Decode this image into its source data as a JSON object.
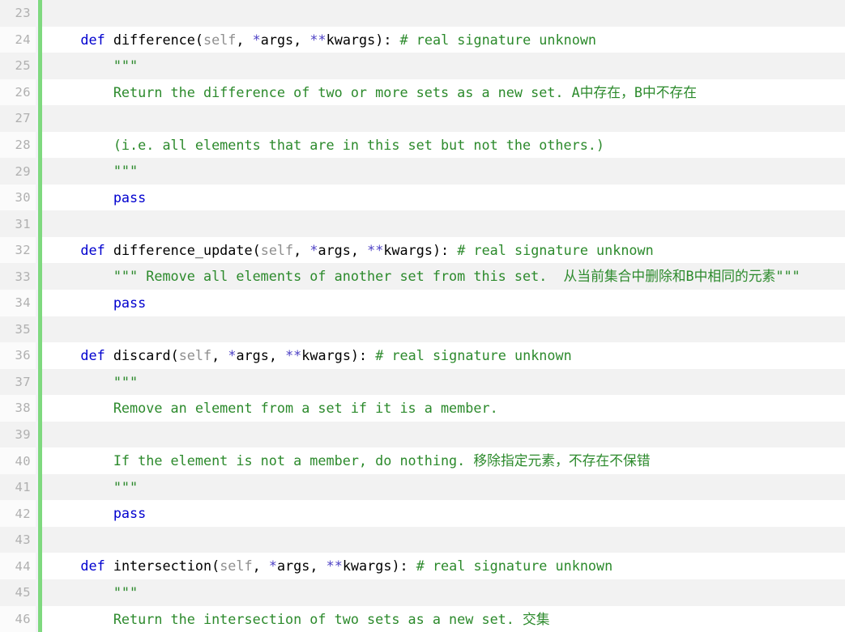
{
  "editor": {
    "language": "python",
    "gutter_marker_color": "#7fd97f",
    "row_shade_odd": "#f2f2f2",
    "row_shade_even": "#ffffff",
    "palette": {
      "keyword": "#0000cf",
      "self": "#8f8f8f",
      "star": "#4b3fc4",
      "comment": "#2c8a2c",
      "docstring": "#2c8a2c",
      "plain": "#000000",
      "line_number": "#b0b0b0"
    },
    "first_line_number": 23,
    "last_line_number": 46
  },
  "lines": [
    {
      "number": "23",
      "tokens": []
    },
    {
      "number": "24",
      "tokens": [
        {
          "t": "indent",
          "v": "    "
        },
        {
          "t": "kw",
          "v": "def"
        },
        {
          "t": "plain",
          "v": " "
        },
        {
          "t": "name",
          "v": "difference"
        },
        {
          "t": "punct",
          "v": "("
        },
        {
          "t": "self",
          "v": "self"
        },
        {
          "t": "punct",
          "v": ", "
        },
        {
          "t": "star",
          "v": "*"
        },
        {
          "t": "name",
          "v": "args"
        },
        {
          "t": "punct",
          "v": ", "
        },
        {
          "t": "star",
          "v": "**"
        },
        {
          "t": "name",
          "v": "kwargs"
        },
        {
          "t": "punct",
          "v": "): "
        },
        {
          "t": "comment",
          "v": "# real signature unknown"
        }
      ]
    },
    {
      "number": "25",
      "tokens": [
        {
          "t": "indent",
          "v": "        "
        },
        {
          "t": "doc",
          "v": "\"\"\""
        }
      ]
    },
    {
      "number": "26",
      "tokens": [
        {
          "t": "indent",
          "v": "        "
        },
        {
          "t": "doc",
          "v": "Return the difference of two or more sets as a new set. "
        },
        {
          "t": "cn",
          "v": "A中存在，B中不存在"
        }
      ]
    },
    {
      "number": "27",
      "tokens": []
    },
    {
      "number": "28",
      "tokens": [
        {
          "t": "indent",
          "v": "        "
        },
        {
          "t": "doc",
          "v": "(i.e. all elements that are in this set but not the others.)"
        }
      ]
    },
    {
      "number": "29",
      "tokens": [
        {
          "t": "indent",
          "v": "        "
        },
        {
          "t": "doc",
          "v": "\"\"\""
        }
      ]
    },
    {
      "number": "30",
      "tokens": [
        {
          "t": "indent",
          "v": "        "
        },
        {
          "t": "kw",
          "v": "pass"
        }
      ]
    },
    {
      "number": "31",
      "tokens": []
    },
    {
      "number": "32",
      "tokens": [
        {
          "t": "indent",
          "v": "    "
        },
        {
          "t": "kw",
          "v": "def"
        },
        {
          "t": "plain",
          "v": " "
        },
        {
          "t": "name",
          "v": "difference_update"
        },
        {
          "t": "punct",
          "v": "("
        },
        {
          "t": "self",
          "v": "self"
        },
        {
          "t": "punct",
          "v": ", "
        },
        {
          "t": "star",
          "v": "*"
        },
        {
          "t": "name",
          "v": "args"
        },
        {
          "t": "punct",
          "v": ", "
        },
        {
          "t": "star",
          "v": "**"
        },
        {
          "t": "name",
          "v": "kwargs"
        },
        {
          "t": "punct",
          "v": "): "
        },
        {
          "t": "comment",
          "v": "# real signature unknown"
        }
      ]
    },
    {
      "number": "33",
      "tokens": [
        {
          "t": "indent",
          "v": "        "
        },
        {
          "t": "doc",
          "v": "\"\"\" Remove all elements of another set from this set.  "
        },
        {
          "t": "cn",
          "v": "从当前集合中删除和B中相同的元素"
        },
        {
          "t": "doc",
          "v": "\"\"\""
        }
      ]
    },
    {
      "number": "34",
      "tokens": [
        {
          "t": "indent",
          "v": "        "
        },
        {
          "t": "kw",
          "v": "pass"
        }
      ]
    },
    {
      "number": "35",
      "tokens": []
    },
    {
      "number": "36",
      "tokens": [
        {
          "t": "indent",
          "v": "    "
        },
        {
          "t": "kw",
          "v": "def"
        },
        {
          "t": "plain",
          "v": " "
        },
        {
          "t": "name",
          "v": "discard"
        },
        {
          "t": "punct",
          "v": "("
        },
        {
          "t": "self",
          "v": "self"
        },
        {
          "t": "punct",
          "v": ", "
        },
        {
          "t": "star",
          "v": "*"
        },
        {
          "t": "name",
          "v": "args"
        },
        {
          "t": "punct",
          "v": ", "
        },
        {
          "t": "star",
          "v": "**"
        },
        {
          "t": "name",
          "v": "kwargs"
        },
        {
          "t": "punct",
          "v": "): "
        },
        {
          "t": "comment",
          "v": "# real signature unknown"
        }
      ]
    },
    {
      "number": "37",
      "tokens": [
        {
          "t": "indent",
          "v": "        "
        },
        {
          "t": "doc",
          "v": "\"\"\""
        }
      ]
    },
    {
      "number": "38",
      "tokens": [
        {
          "t": "indent",
          "v": "        "
        },
        {
          "t": "doc",
          "v": "Remove an element from a set if it is a member."
        }
      ]
    },
    {
      "number": "39",
      "tokens": []
    },
    {
      "number": "40",
      "tokens": [
        {
          "t": "indent",
          "v": "        "
        },
        {
          "t": "doc",
          "v": "If the element is not a member, do nothing. "
        },
        {
          "t": "cn",
          "v": "移除指定元素，不存在不保错"
        }
      ]
    },
    {
      "number": "41",
      "tokens": [
        {
          "t": "indent",
          "v": "        "
        },
        {
          "t": "doc",
          "v": "\"\"\""
        }
      ]
    },
    {
      "number": "42",
      "tokens": [
        {
          "t": "indent",
          "v": "        "
        },
        {
          "t": "kw",
          "v": "pass"
        }
      ]
    },
    {
      "number": "43",
      "tokens": []
    },
    {
      "number": "44",
      "tokens": [
        {
          "t": "indent",
          "v": "    "
        },
        {
          "t": "kw",
          "v": "def"
        },
        {
          "t": "plain",
          "v": " "
        },
        {
          "t": "name",
          "v": "intersection"
        },
        {
          "t": "punct",
          "v": "("
        },
        {
          "t": "self",
          "v": "self"
        },
        {
          "t": "punct",
          "v": ", "
        },
        {
          "t": "star",
          "v": "*"
        },
        {
          "t": "name",
          "v": "args"
        },
        {
          "t": "punct",
          "v": ", "
        },
        {
          "t": "star",
          "v": "**"
        },
        {
          "t": "name",
          "v": "kwargs"
        },
        {
          "t": "punct",
          "v": "): "
        },
        {
          "t": "comment",
          "v": "# real signature unknown"
        }
      ]
    },
    {
      "number": "45",
      "tokens": [
        {
          "t": "indent",
          "v": "        "
        },
        {
          "t": "doc",
          "v": "\"\"\""
        }
      ]
    },
    {
      "number": "46",
      "tokens": [
        {
          "t": "indent",
          "v": "        "
        },
        {
          "t": "doc",
          "v": "Return the intersection of two sets as a new set. "
        },
        {
          "t": "cn",
          "v": "交集"
        }
      ]
    }
  ]
}
